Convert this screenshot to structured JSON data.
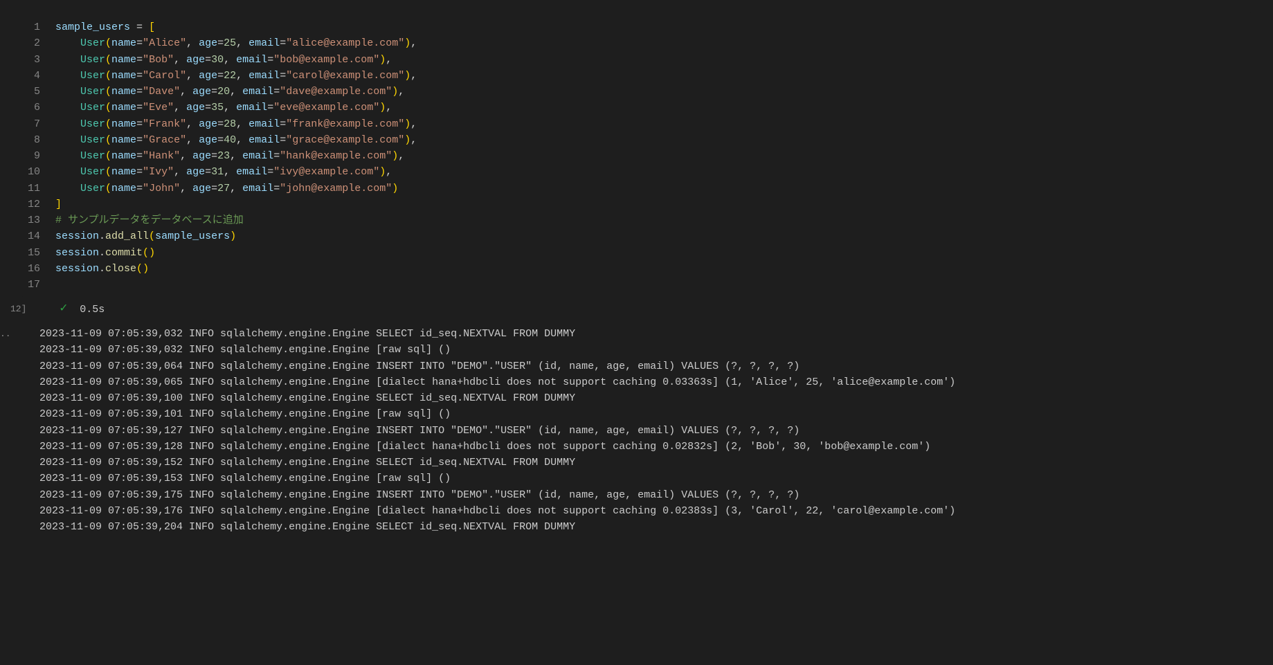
{
  "cell_label": "12]",
  "output_label": "..",
  "exec_time": "0.5s",
  "comment": "# サンプルデータをデータベースに追加",
  "code": {
    "var_name": "sample_users",
    "users": [
      {
        "name": "Alice",
        "age": 25,
        "email": "alice@example.com",
        "trailing": ","
      },
      {
        "name": "Bob",
        "age": 30,
        "email": "bob@example.com",
        "trailing": ","
      },
      {
        "name": "Carol",
        "age": 22,
        "email": "carol@example.com",
        "trailing": ","
      },
      {
        "name": "Dave",
        "age": 20,
        "email": "dave@example.com",
        "trailing": ","
      },
      {
        "name": "Eve",
        "age": 35,
        "email": "eve@example.com",
        "trailing": ","
      },
      {
        "name": "Frank",
        "age": 28,
        "email": "frank@example.com",
        "trailing": ","
      },
      {
        "name": "Grace",
        "age": 40,
        "email": "grace@example.com",
        "trailing": ","
      },
      {
        "name": "Hank",
        "age": 23,
        "email": "hank@example.com",
        "trailing": ","
      },
      {
        "name": "Ivy",
        "age": 31,
        "email": "ivy@example.com",
        "trailing": ","
      },
      {
        "name": "John",
        "age": 27,
        "email": "john@example.com",
        "trailing": ""
      }
    ],
    "tail": [
      {
        "type": "call",
        "obj": "session",
        "method": "add_all",
        "arg": "sample_users"
      },
      {
        "type": "call",
        "obj": "session",
        "method": "commit",
        "arg": ""
      },
      {
        "type": "call",
        "obj": "session",
        "method": "close",
        "arg": ""
      }
    ]
  },
  "output": [
    "2023-11-09 07:05:39,032 INFO sqlalchemy.engine.Engine SELECT id_seq.NEXTVAL FROM DUMMY",
    "2023-11-09 07:05:39,032 INFO sqlalchemy.engine.Engine [raw sql] ()",
    "2023-11-09 07:05:39,064 INFO sqlalchemy.engine.Engine INSERT INTO \"DEMO\".\"USER\" (id, name, age, email) VALUES (?, ?, ?, ?)",
    "2023-11-09 07:05:39,065 INFO sqlalchemy.engine.Engine [dialect hana+hdbcli does not support caching 0.03363s] (1, 'Alice', 25, 'alice@example.com')",
    "2023-11-09 07:05:39,100 INFO sqlalchemy.engine.Engine SELECT id_seq.NEXTVAL FROM DUMMY",
    "2023-11-09 07:05:39,101 INFO sqlalchemy.engine.Engine [raw sql] ()",
    "2023-11-09 07:05:39,127 INFO sqlalchemy.engine.Engine INSERT INTO \"DEMO\".\"USER\" (id, name, age, email) VALUES (?, ?, ?, ?)",
    "2023-11-09 07:05:39,128 INFO sqlalchemy.engine.Engine [dialect hana+hdbcli does not support caching 0.02832s] (2, 'Bob', 30, 'bob@example.com')",
    "2023-11-09 07:05:39,152 INFO sqlalchemy.engine.Engine SELECT id_seq.NEXTVAL FROM DUMMY",
    "2023-11-09 07:05:39,153 INFO sqlalchemy.engine.Engine [raw sql] ()",
    "2023-11-09 07:05:39,175 INFO sqlalchemy.engine.Engine INSERT INTO \"DEMO\".\"USER\" (id, name, age, email) VALUES (?, ?, ?, ?)",
    "2023-11-09 07:05:39,176 INFO sqlalchemy.engine.Engine [dialect hana+hdbcli does not support caching 0.02383s] (3, 'Carol', 22, 'carol@example.com')",
    "2023-11-09 07:05:39,204 INFO sqlalchemy.engine.Engine SELECT id_seq.NEXTVAL FROM DUMMY"
  ]
}
